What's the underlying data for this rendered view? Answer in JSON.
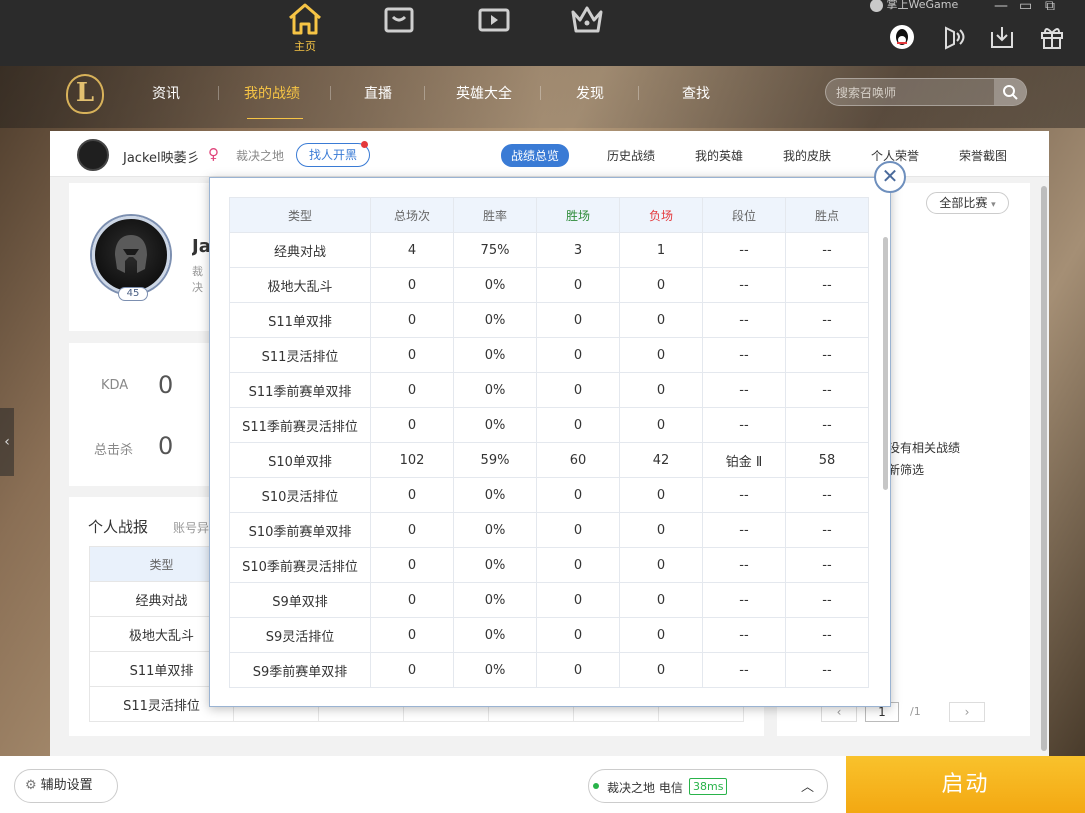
{
  "topbar": {
    "nav": [
      {
        "label": "主页",
        "icon": "home-icon"
      },
      {
        "label": "",
        "icon": "store-icon"
      },
      {
        "label": "",
        "icon": "video-icon"
      },
      {
        "label": "",
        "icon": "crown-icon"
      }
    ],
    "brand": "掌上WeGame",
    "window_min": "—",
    "window_restore": "▭",
    "window_box": "⧉"
  },
  "nav2": {
    "items": [
      "资讯",
      "我的战绩",
      "直播",
      "英雄大全",
      "发现",
      "查找"
    ],
    "search_placeholder": "搜索召唤师",
    "logo_letter": "L"
  },
  "profile": {
    "name": "Jackel映萎彡",
    "gender_symbol": "♀",
    "server": "裁决之地",
    "blacklist_button": "找人开黑",
    "tabs": [
      "战绩总览",
      "历史战绩",
      "我的英雄",
      "我的皮肤",
      "个人荣誉",
      "荣誉截图"
    ],
    "level": "45",
    "name_short": "Ja",
    "server_short": "裁决",
    "stats": {
      "kda_label": "KDA",
      "kda_value": "0",
      "kills_label": "总击杀",
      "kills_value": "0"
    }
  },
  "report": {
    "title": "个人战报",
    "subtitle": "账号异常",
    "type_header": "类型",
    "rows": [
      "经典对战",
      "极地大乱斗",
      "S11单双排",
      "S11灵活排位"
    ]
  },
  "right": {
    "filter": "全部比赛",
    "no_record_1": "没有相关战绩",
    "no_record_2": "新筛选",
    "page_current": "1",
    "page_total": "/1",
    "prev": "‹",
    "next": "›"
  },
  "popup": {
    "headers": [
      "类型",
      "总场次",
      "胜率",
      "胜场",
      "负场",
      "段位",
      "胜点"
    ],
    "header_colors": {
      "wins": "#2e8b3a",
      "losses": "#e4393c"
    },
    "rows": [
      [
        "经典对战",
        "4",
        "75%",
        "3",
        "1",
        "--",
        "--"
      ],
      [
        "极地大乱斗",
        "0",
        "0%",
        "0",
        "0",
        "--",
        "--"
      ],
      [
        "S11单双排",
        "0",
        "0%",
        "0",
        "0",
        "--",
        "--"
      ],
      [
        "S11灵活排位",
        "0",
        "0%",
        "0",
        "0",
        "--",
        "--"
      ],
      [
        "S11季前赛单双排",
        "0",
        "0%",
        "0",
        "0",
        "--",
        "--"
      ],
      [
        "S11季前赛灵活排位",
        "0",
        "0%",
        "0",
        "0",
        "--",
        "--"
      ],
      [
        "S10单双排",
        "102",
        "59%",
        "60",
        "42",
        "铂金 Ⅱ",
        "58"
      ],
      [
        "S10灵活排位",
        "0",
        "0%",
        "0",
        "0",
        "--",
        "--"
      ],
      [
        "S10季前赛单双排",
        "0",
        "0%",
        "0",
        "0",
        "--",
        "--"
      ],
      [
        "S10季前赛灵活排位",
        "0",
        "0%",
        "0",
        "0",
        "--",
        "--"
      ],
      [
        "S9单双排",
        "0",
        "0%",
        "0",
        "0",
        "--",
        "--"
      ],
      [
        "S9灵活排位",
        "0",
        "0%",
        "0",
        "0",
        "--",
        "--"
      ],
      [
        "S9季前赛单双排",
        "0",
        "0%",
        "0",
        "0",
        "--",
        "--"
      ]
    ],
    "close_symbol": "✕"
  },
  "bottom": {
    "assist_label": "辅助设置",
    "server_name": "裁决之地 电信",
    "ping": "38ms",
    "start_label": "启动"
  },
  "colors": {
    "accent": "#3a7bd5",
    "gold": "#f6c445",
    "start": "#f3a812"
  }
}
